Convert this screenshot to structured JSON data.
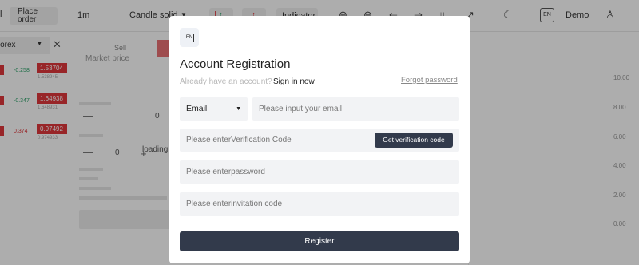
{
  "topbar": {
    "left_edge": "l",
    "place_order": "Place order",
    "interval": "1m",
    "chart_type": "Candle solid",
    "indicator": "Indicator",
    "demo": "Demo",
    "language_badge": "EN"
  },
  "left_panel": {
    "market": "Forex",
    "rows": [
      {
        "change": "-0.258",
        "price": "1.53704",
        "sub": "1.538945"
      },
      {
        "change": "-0.347",
        "price": "1.64938",
        "sub": "1.648931"
      },
      {
        "change": "0.374",
        "price": "0.97492",
        "sub": "0.974933"
      }
    ]
  },
  "order_panel": {
    "tab": "Market price",
    "sell": "Sell",
    "qty_value": "0",
    "amount_value": "0",
    "loading": "loading"
  },
  "chart_axis": [
    "10.00",
    "8.00",
    "6.00",
    "4.00",
    "2.00",
    "0.00"
  ],
  "modal": {
    "logo_text": "EN",
    "title": "Account Registration",
    "have_account": "Already have an account?",
    "sign_in": "Sign in now",
    "forgot": "Forgot password",
    "method": "Email",
    "email_placeholder": "Please input your email",
    "code_placeholder": "Please enterVerification Code",
    "get_code": "Get verification code",
    "password_placeholder": "Please enterpassword",
    "invite_placeholder": "Please enterinvitation code",
    "register": "Register"
  }
}
